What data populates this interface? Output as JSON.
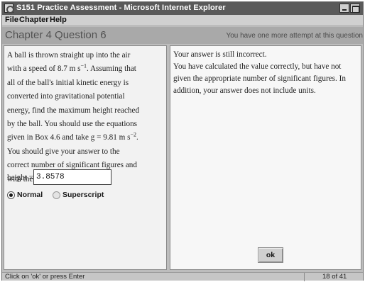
{
  "window": {
    "title": "S151 Practice Assessment - Microsoft Internet Explorer"
  },
  "menu": {
    "items": [
      "File",
      "Chapter",
      "Help"
    ]
  },
  "header": {
    "chapter_title": "Chapter 4 Question 6",
    "attempt_notice": "You have one more attempt at this question"
  },
  "question": {
    "lines": [
      "A ball is thrown straight up into the air",
      "with a speed of 8.7 m s",
      "−1",
      ". Assuming that",
      "all of the ball's initial kinetic energy is",
      "converted into gravitational potential",
      "energy, find the maximum height reached",
      "by the ball. You should use the equations",
      "given in Box 4.6 and take g = 9.81 m s",
      "−2",
      ".",
      "You should give your answer to the",
      "correct number of significant figures and",
      "with the correct SI units."
    ],
    "answer_label": "height =",
    "answer_value": "3.8578",
    "format_options": [
      "Normal",
      "Superscript"
    ],
    "selected_format": "Normal"
  },
  "feedback": {
    "line1": "Your answer is still incorrect.",
    "line2": "You have calculated the value correctly, but have not given the appropriate number of significant figures. In addition, your answer does not include units.",
    "ok_label": "ok"
  },
  "status": {
    "text": "Click on 'ok' or press Enter",
    "page_counter": "18 of 41"
  }
}
